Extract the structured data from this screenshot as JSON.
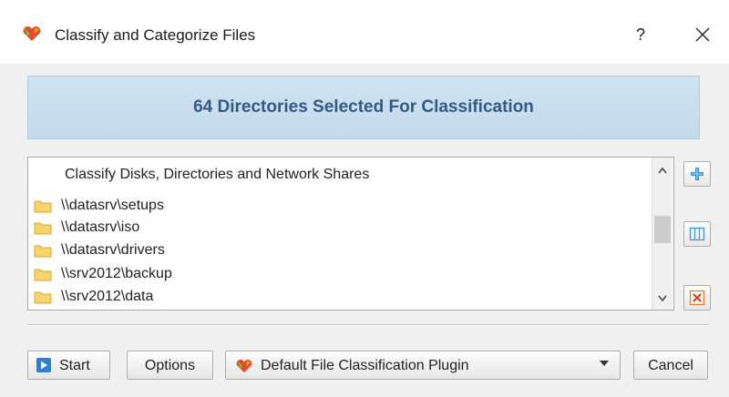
{
  "window": {
    "title": "Classify and Categorize Files",
    "help_label": "?",
    "close_label": "✕"
  },
  "banner": {
    "text": "64 Directories Selected For Classification"
  },
  "list": {
    "header": "Classify Disks, Directories and Network Shares",
    "items": [
      {
        "label": "\\\\datasrv\\setups"
      },
      {
        "label": "\\\\datasrv\\iso"
      },
      {
        "label": "\\\\datasrv\\drivers"
      },
      {
        "label": "\\\\srv2012\\backup"
      },
      {
        "label": "\\\\srv2012\\data"
      }
    ],
    "scroll_up": "^",
    "scroll_down": "v"
  },
  "side_buttons": [
    {
      "icon": "add-icon"
    },
    {
      "icon": "columns-icon"
    },
    {
      "icon": "remove-icon"
    }
  ],
  "buttons": {
    "start_label": "Start",
    "options_label": "Options",
    "plugin_selected": "Default File Classification Plugin",
    "cancel_label": "Cancel"
  },
  "colors": {
    "banner_bg": "#cfe3f1",
    "banner_text": "#345a82",
    "accent": "#2e7bc4"
  }
}
